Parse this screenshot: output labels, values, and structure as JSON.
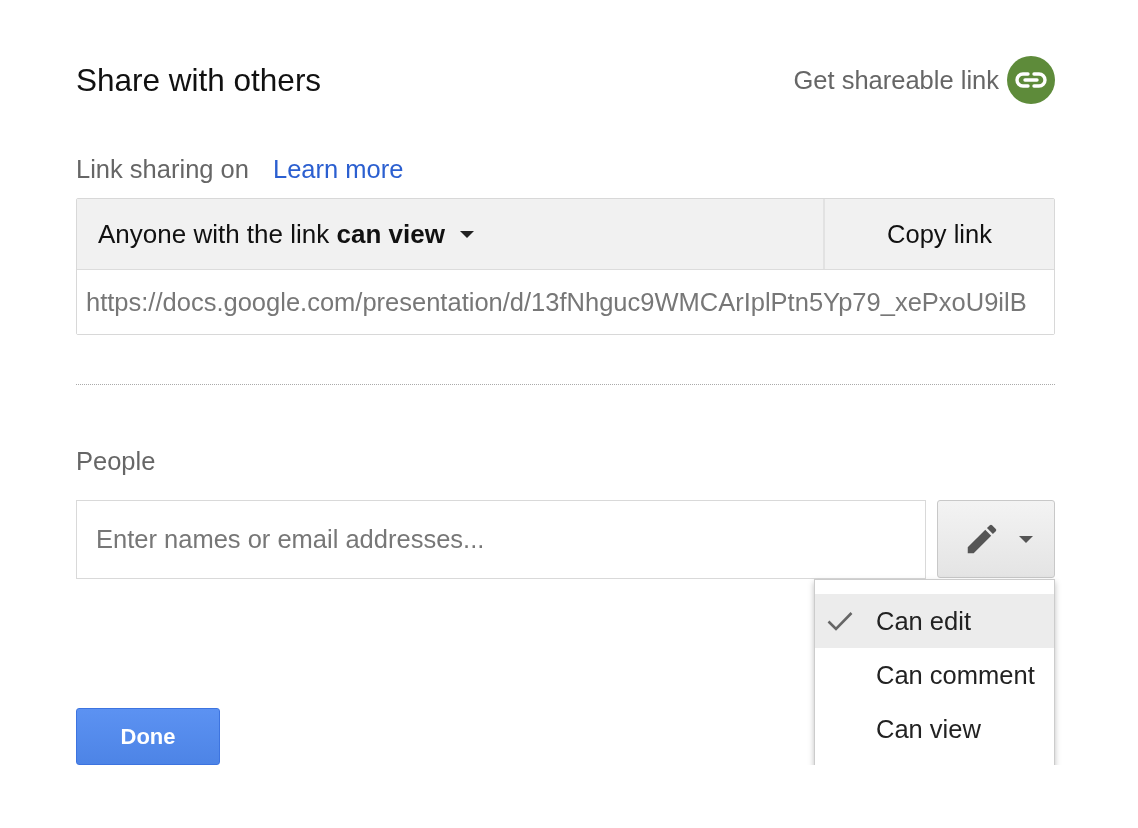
{
  "dialog": {
    "title": "Share with others",
    "get_link": {
      "label": "Get shareable link",
      "enabled": true
    }
  },
  "link_sharing": {
    "label": "Link sharing on",
    "learn_more": "Learn more",
    "access": "Anyone with the link **can view**",
    "copy_button": "Copy link",
    "url": "https://docs.google.com/presentation/d/13fNhguc9WMCArIplPtn5Yp79_xePxoU9ilB"
  },
  "people": {
    "label": "People",
    "placeholder": "Enter names or email addresses..."
  },
  "permission_menu": {
    "expanded": true,
    "items": [
      {
        "label": "Can edit",
        "selected": true
      },
      {
        "label": "Can comment",
        "selected": false
      },
      {
        "label": "Can view",
        "selected": false
      }
    ]
  },
  "done_button": "Done"
}
